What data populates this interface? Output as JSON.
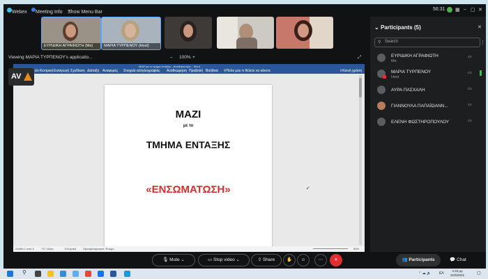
{
  "window": {
    "app_name": "Webex",
    "meeting_info": "Meeting Info",
    "show_menu_bar": "Show Menu Bar",
    "clock": "56:31"
  },
  "videos": [
    {
      "name": "ΕΥΡΙΔΙΚΗ ΑΓΡΑΦΙΩΤΗ (Me)"
    },
    {
      "name": "ΜΑΡΙΑ ΤΥΡΠΕΝΟΥ (Host)"
    },
    {
      "name": ""
    },
    {
      "name": ""
    },
    {
      "name": ""
    }
  ],
  "share": {
    "viewing": "Viewing ΜΑΡΙΑ ΤΥΡΠΕΝΟΥ's applicatio...",
    "zoom": "100%"
  },
  "logo": {
    "text": "AV"
  },
  "word": {
    "title": "ΜΑΖΙ με το τμήμα ένταξης - Αποθηκεύτηκε - Word",
    "tabs": [
      "Αρχείο",
      "Κεντρική",
      "Εισαγωγή",
      "Σχεδίαση",
      "Διάταξη",
      "Αναφορές",
      "Στοιχεία αλληλογραφίας",
      "Αναθεώρηση",
      "Προβολή",
      "Βοήθεια"
    ],
    "tell_me": "Πείτε μου τι θέλετε να κάνετε",
    "share": "Κοινή χρήση",
    "status": {
      "page": "Σελίδα 1 από 4",
      "words": "717 λέξεις",
      "lang": "Ελληνικά",
      "accessibility": "Προσβασιμότητα: Έτοιμο",
      "zoom": "90%"
    }
  },
  "document": {
    "line1": "ΜΑΖΙ",
    "line2": "με το",
    "line3": "ΤΜΗΜΑ ΕΝΤΑΞΗΣ",
    "line4": "«ΕΝΣΩΜΑΤΩΣΗ»"
  },
  "participants": {
    "title": "Participants (5)",
    "search_placeholder": "Search",
    "items": [
      {
        "name": "ΕΥΡΙΔΙΚΗ ΑΓΡΑΦΙΩΤΗ",
        "role": "Me"
      },
      {
        "name": "ΜΑΡΙΑ ΤΥΡΠΕΝΟΥ",
        "role": "Host"
      },
      {
        "name": "ΑΥΡΑ ΠΑΣΧΑΛΗ",
        "role": ""
      },
      {
        "name": "ΓΙΑΝΝΟΥΛΑ ΠΑΠΑΪΩΑΝΝ...",
        "role": ""
      },
      {
        "name": "ΕΛΕΝΗ ΦΩΣΤΗΡΟΠΟΥΛΟΥ",
        "role": ""
      }
    ]
  },
  "controls": {
    "mute": "Mute",
    "stop_video": "Stop video",
    "share": "Share",
    "participants": "Participants",
    "chat": "Chat"
  },
  "taskbar": {
    "time": "4:33 μμ",
    "date": "31/5/2022",
    "lang": "ΕΛ"
  },
  "colors": {
    "accent_red": "#e02f2f",
    "word_blue": "#2b579a",
    "doc_red": "#d32f2f"
  }
}
